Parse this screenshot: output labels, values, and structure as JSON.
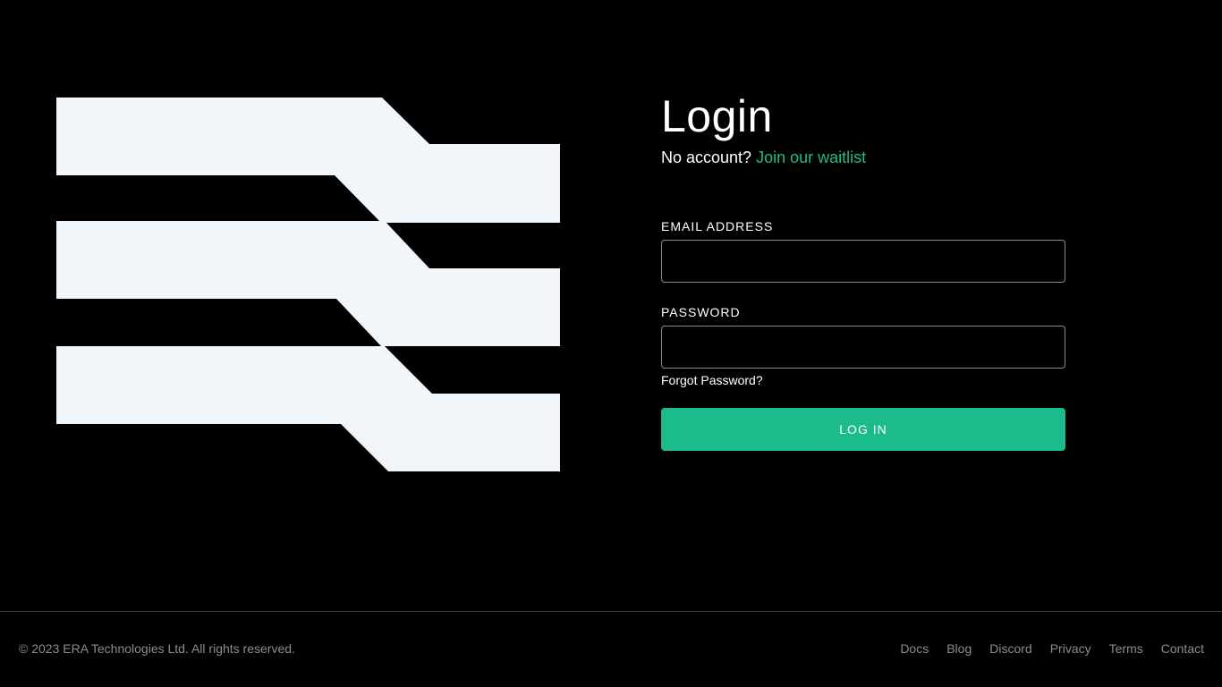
{
  "login": {
    "title": "Login",
    "no_account_text": "No account?",
    "waitlist_link": "Join our waitlist",
    "email_label": "EMAIL ADDRESS",
    "email_value": "",
    "password_label": "PASSWORD",
    "password_value": "",
    "forgot_password": "Forgot Password?",
    "submit_label": "LOG IN"
  },
  "footer": {
    "copyright": "© 2023 ERA Technologies Ltd. All rights reserved.",
    "links": [
      "Docs",
      "Blog",
      "Discord",
      "Privacy",
      "Terms",
      "Contact"
    ]
  },
  "colors": {
    "background": "#000000",
    "accent": "#1cbb8c",
    "logo_fill": "#f0f6fa",
    "muted_text": "#8c8c8c"
  },
  "icons": {
    "logo": "era-stripes-logo"
  }
}
